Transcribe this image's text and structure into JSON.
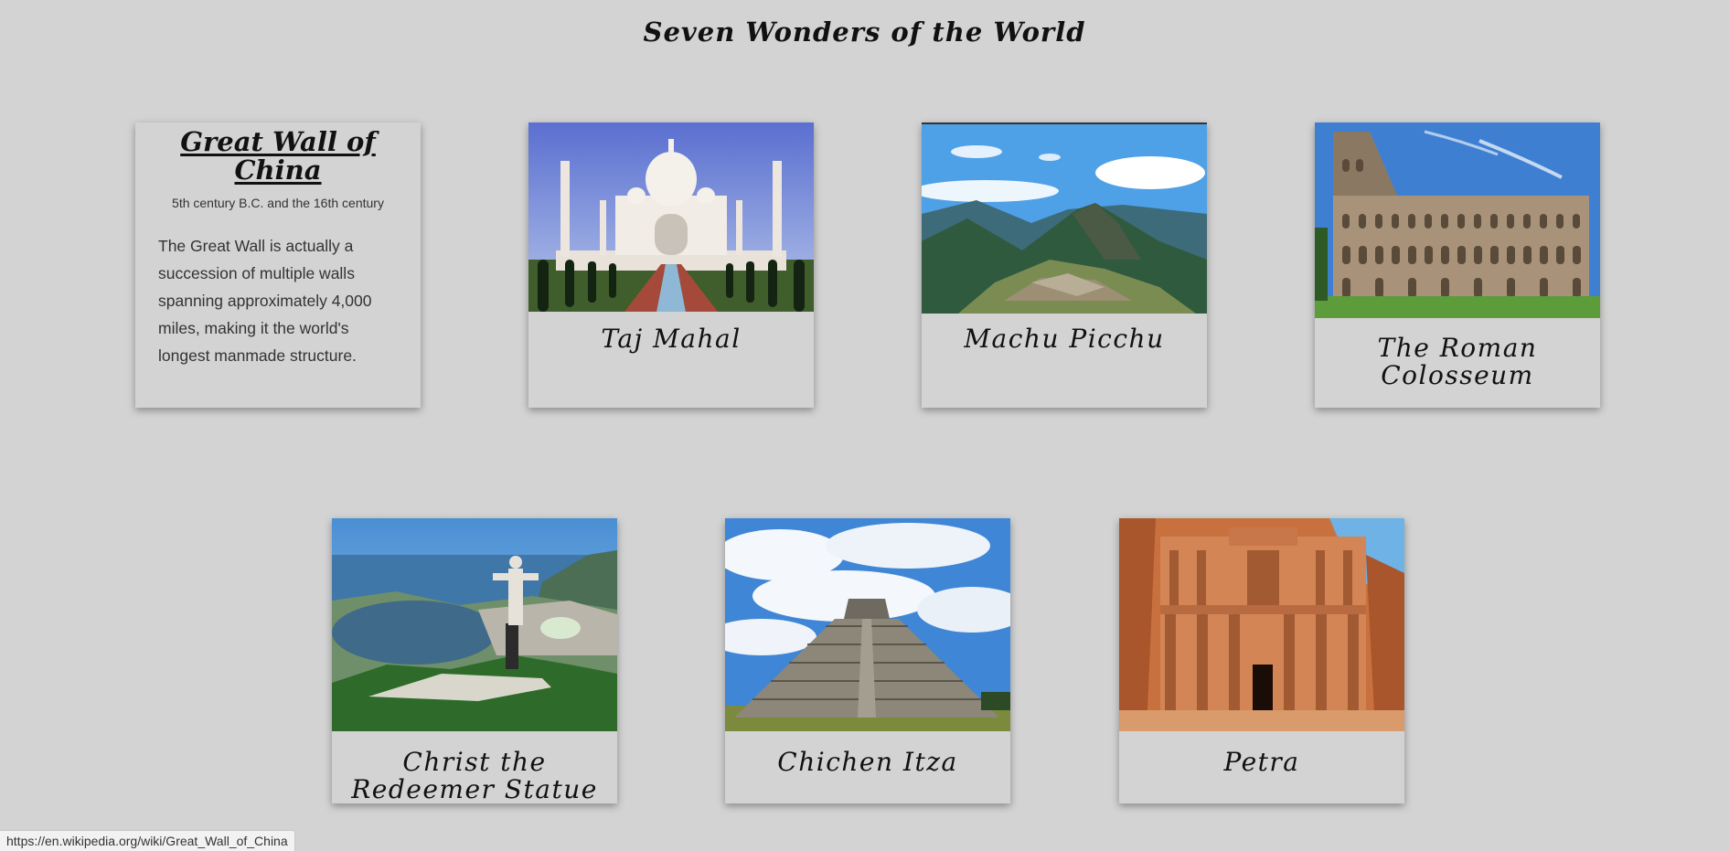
{
  "page": {
    "title": "Seven Wonders of the World"
  },
  "wonders": [
    {
      "name": "Great Wall of China",
      "date": "5th century B.C. and the 16th century",
      "description": "The Great Wall is actually a succession of multiple walls spanning approximately 4,000 miles, making it the world's longest manmade structure."
    },
    {
      "name": "Taj Mahal",
      "image": "taj-mahal-photo"
    },
    {
      "name": "Machu Picchu",
      "image": "machu-picchu-photo"
    },
    {
      "name": "The Roman Colosseum",
      "image": "colosseum-photo"
    },
    {
      "name": "Christ the Redeemer Statue",
      "image": "christ-redeemer-photo"
    },
    {
      "name": "Chichen Itza",
      "image": "chichen-itza-photo"
    },
    {
      "name": "Petra",
      "image": "petra-photo"
    }
  ],
  "status_bar": {
    "url": "https://en.wikipedia.org/wiki/Great_Wall_of_China"
  },
  "colors": {
    "background": "#d3d3d3",
    "text": "#111111"
  }
}
